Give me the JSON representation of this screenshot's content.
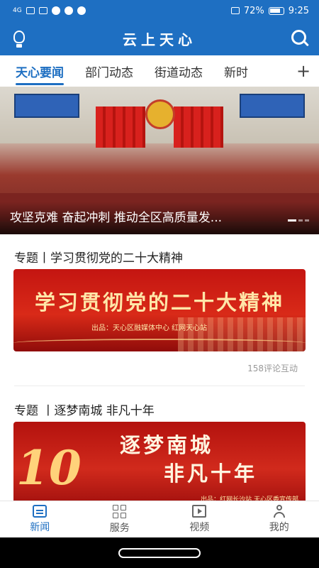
{
  "status_bar": {
    "network": "4G",
    "battery": "72%",
    "time": "9:25"
  },
  "app_bar": {
    "title": "云上天心"
  },
  "tabs": [
    {
      "label": "天心要闻",
      "active": true
    },
    {
      "label": "部门动态",
      "active": false
    },
    {
      "label": "街道动态",
      "active": false
    },
    {
      "label": "新时",
      "active": false
    }
  ],
  "tab_add_label": "+",
  "hero": {
    "caption": "攻坚克难 奋起冲刺 推动全区高质量发...",
    "slide_count": 3,
    "active_slide": 1
  },
  "sections": [
    {
      "title": "专题丨学习贯彻党的二十大精神",
      "banner_title": "学习贯彻党的二十大精神",
      "banner_sub": "出品：天心区融媒体中心 红网天心站",
      "comments": "158评论互动"
    },
    {
      "title": "专题 丨逐梦南城 非凡十年",
      "banner_num": "10",
      "banner_line1": "逐梦南城",
      "banner_line2": "非凡十年",
      "banner_sub": "出品：红网长沙站 天心区委宣传部"
    }
  ],
  "bottom_nav": [
    {
      "label": "新闻",
      "icon": "news-icon",
      "active": true
    },
    {
      "label": "服务",
      "icon": "grid-icon",
      "active": false
    },
    {
      "label": "视频",
      "icon": "video-icon",
      "active": false
    },
    {
      "label": "我的",
      "icon": "user-icon",
      "active": false
    }
  ],
  "colors": {
    "primary": "#1e6fc2",
    "banner_red": "#c41511",
    "banner_gold": "#ffe6a8"
  }
}
